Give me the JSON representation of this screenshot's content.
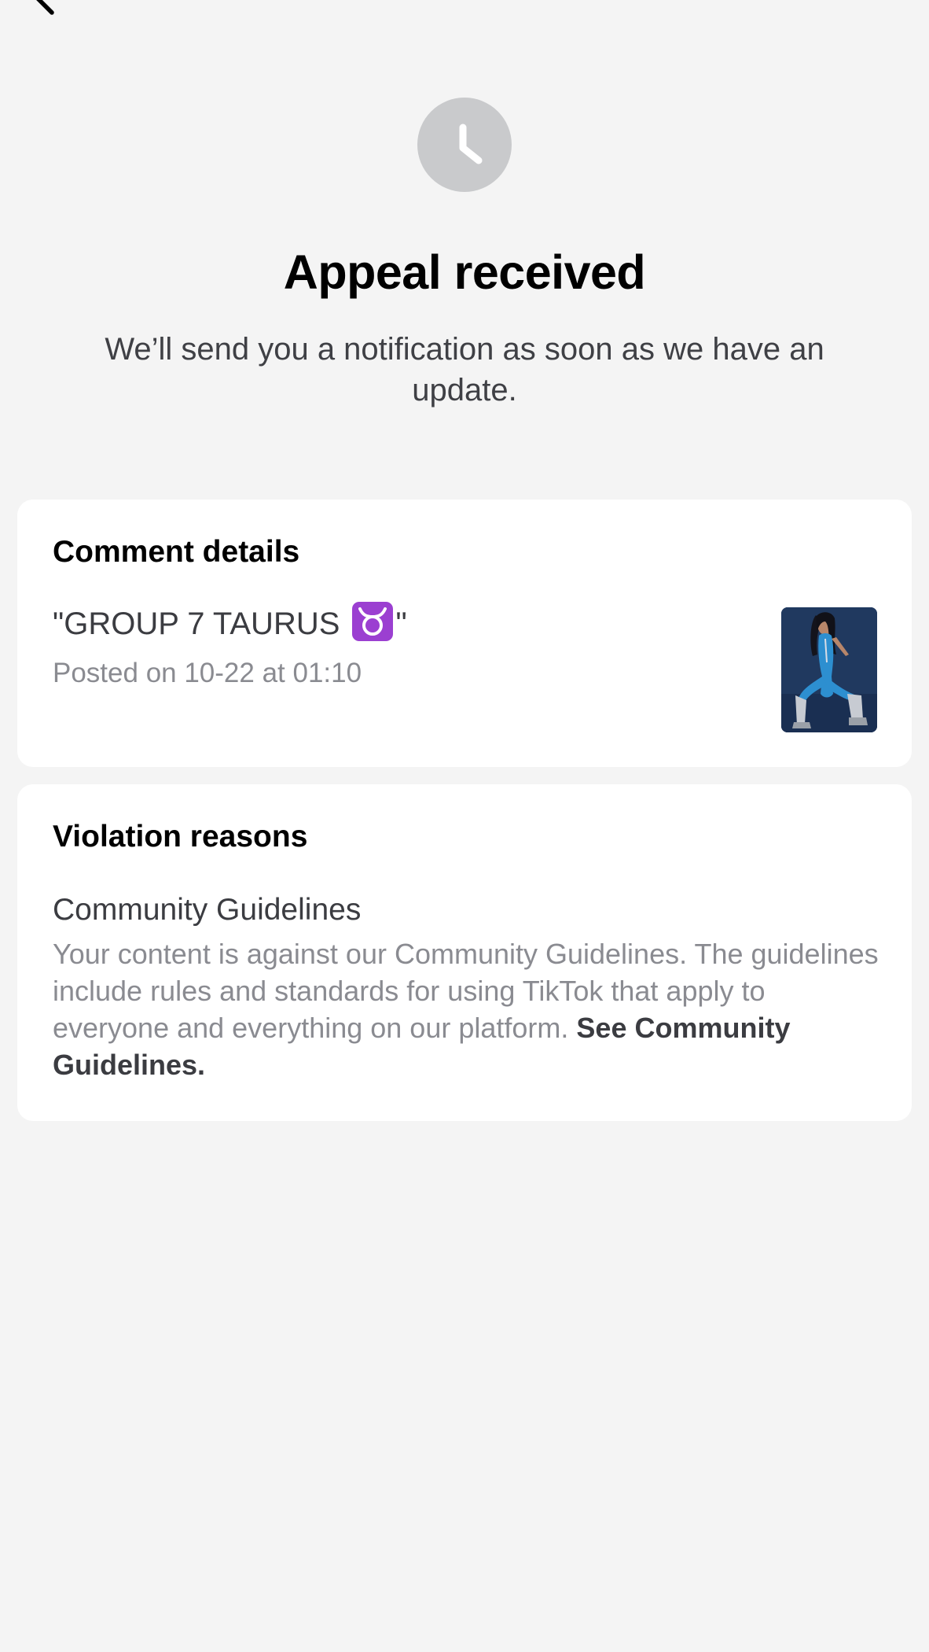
{
  "header": {
    "back_icon": "chevron-left-icon"
  },
  "status": {
    "icon": "clock-icon",
    "icon_color": "#c9cacc",
    "title": "Appeal received",
    "subtitle": "We’ll send you a notification as soon as we have an update."
  },
  "comment_details": {
    "heading": "Comment details",
    "comment_prefix": "\"GROUP 7 TAURUS",
    "comment_emoji": "taurus-emoji-icon",
    "comment_suffix": "\"",
    "posted": "Posted on 10-22 at 01:10",
    "thumbnail": "video-thumbnail"
  },
  "violation": {
    "heading": "Violation reasons",
    "reason_title": "Community Guidelines",
    "reason_body": "Your content is against our Community Guidelines. The guidelines include rules and standards for using TikTok that apply to everyone and everything on our platform.",
    "link_label": "See Community Guidelines."
  }
}
